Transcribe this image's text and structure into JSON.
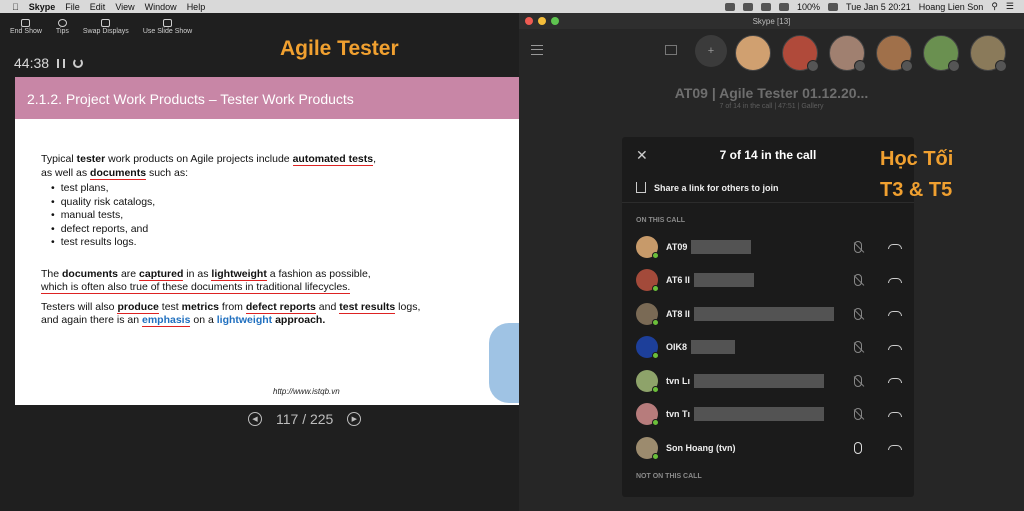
{
  "menubar": {
    "app": "Skype",
    "items": [
      "File",
      "Edit",
      "View",
      "Window",
      "Help"
    ],
    "battery": "100%",
    "datetime": "Tue Jan 5  20:21",
    "user": "Hoang Lien Son"
  },
  "slideshow": {
    "toolbar": [
      "End Show",
      "Tips",
      "Swap Displays",
      "Use Slide Show"
    ],
    "timer": "44:38",
    "overlay_title": "Agile Tester",
    "slide": {
      "heading": "2.1.2. Project Work Products – Tester Work Products",
      "p1_a": "Typical ",
      "p1_b": "tester",
      "p1_c": " work products on Agile projects include ",
      "p1_d": "automated tests",
      "p1_e": ",",
      "p1_f": "as well as ",
      "p1_g": "documents",
      "p1_h": " such as:",
      "bullets": [
        "test plans,",
        "quality risk catalogs,",
        "manual tests,",
        "defect reports, and",
        "test results logs."
      ],
      "p2_a": "The ",
      "p2_b": "documents",
      "p2_c": " are ",
      "p2_d": "captured",
      "p2_e": " in as ",
      "p2_f": "lightweight",
      "p2_g": " a fashion as possible,",
      "p2_h": "which is often also true of these documents in traditional lifecycles.",
      "p3_a": "Testers will also ",
      "p3_b": "produce",
      "p3_c": " test ",
      "p3_d": "metrics",
      "p3_e": " from ",
      "p3_f": "defect reports",
      "p3_g": " and ",
      "p3_h": "test results",
      "p3_i": " logs,",
      "p3_j": "and again there is an ",
      "p3_k": "emphasis",
      "p3_l": " on a ",
      "p3_m": "lightweight",
      "p3_n": " approach.",
      "url": "http://www.istqb.vn"
    },
    "page_indicator": "117 / 225"
  },
  "skype": {
    "window_title": "Skype [13]",
    "meeting_title": "AT09 | Agile Tester 01.12.20...",
    "meeting_sub": "7 of 14 in the call | 47:51 |  Gallery",
    "panel": {
      "count": "7 of 14 in the call",
      "share": "Share a link for others to join",
      "on_call": "ON THIS CALL",
      "not_on_call": "NOT ON THIS CALL",
      "participants": [
        {
          "name": "AT09",
          "mic": "muted",
          "color": "#c79a6a",
          "blur": 60
        },
        {
          "name": "AT6 II",
          "mic": "muted",
          "color": "#a34a3a",
          "blur": 60
        },
        {
          "name": "AT8 II",
          "mic": "muted",
          "color": "#7a6a55",
          "blur": 140
        },
        {
          "name": "OIK8",
          "mic": "muted",
          "color": "#1d3f9a",
          "blur": 44
        },
        {
          "name": "tvn Lı",
          "mic": "muted",
          "color": "#8ea36a",
          "blur": 130
        },
        {
          "name": "tvn Tı",
          "mic": "muted",
          "color": "#b77c7c",
          "blur": 130
        },
        {
          "name": "Son Hoang (tvn)",
          "mic": "on",
          "color": "#9c8b6e",
          "blur": 0
        }
      ]
    },
    "avatar_colors": [
      "#d0a070",
      "#b04a3a",
      "#a08070",
      "#a0704a",
      "#6a9050",
      "#8a7a5a"
    ]
  },
  "overlay_right": [
    "Học Tối",
    "T3 & T5"
  ]
}
